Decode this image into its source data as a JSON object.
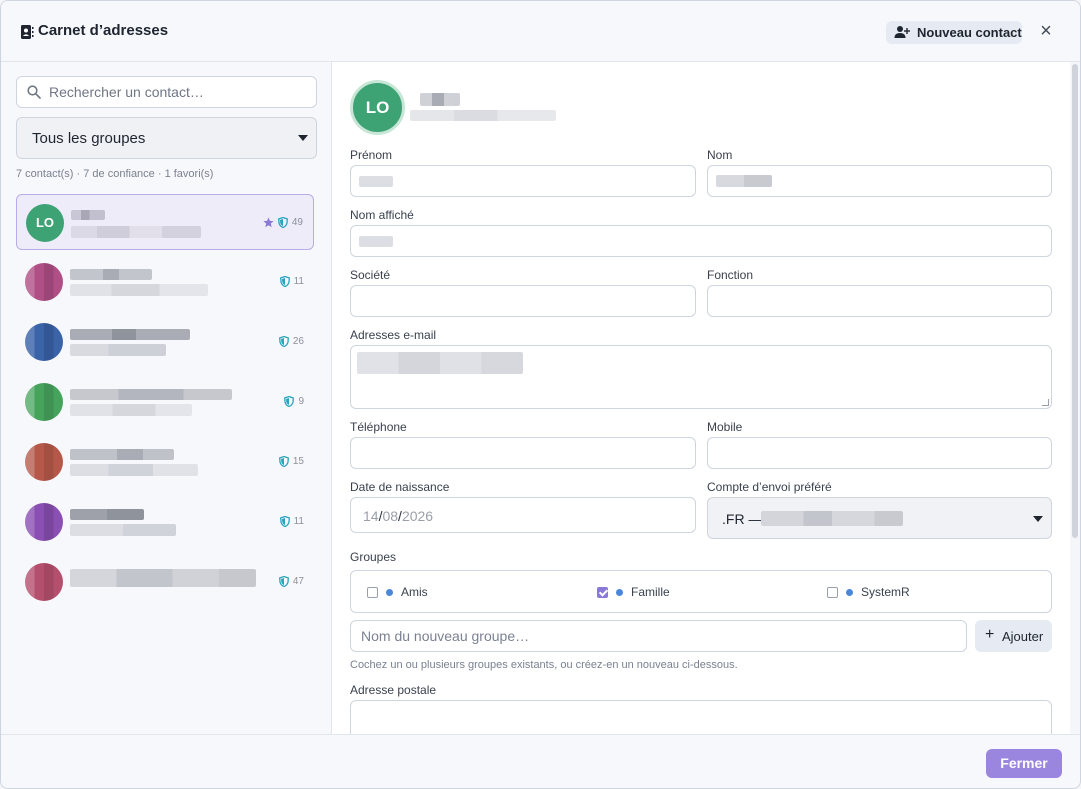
{
  "header": {
    "title": "Carnet d’adresses",
    "new_contact_label": "Nouveau contact",
    "close_symbol": "×",
    "icons": {
      "title": "address-book-icon",
      "new": "user-plus-icon",
      "close": "close-icon"
    }
  },
  "sidebar": {
    "search_placeholder": "Rechercher un contact…",
    "group_filter": "Tous les groupes",
    "stats": "7 contact(s) · 7 de confiance · 1 favori(s)",
    "contacts": [
      {
        "initials": "LO",
        "count": "49",
        "favorite": true,
        "selected": true
      },
      {
        "initials": "",
        "count": "11",
        "favorite": false,
        "selected": false,
        "color": "#b04f86"
      },
      {
        "initials": "",
        "count": "26",
        "favorite": false,
        "selected": false,
        "color": "#3a63a8"
      },
      {
        "initials": "",
        "count": "9",
        "favorite": false,
        "selected": false,
        "color": "#46a35c"
      },
      {
        "initials": "",
        "count": "15",
        "favorite": false,
        "selected": false,
        "color": "#b5584a"
      },
      {
        "initials": "",
        "count": "11",
        "favorite": false,
        "selected": false,
        "color": "#8a4fb3"
      },
      {
        "initials": "",
        "count": "47",
        "favorite": false,
        "selected": false,
        "color": "#b54f6e"
      }
    ]
  },
  "form": {
    "avatar_initials": "LO",
    "labels": {
      "first_name": "Prénom",
      "last_name": "Nom",
      "display_name": "Nom affiché",
      "company": "Société",
      "job": "Fonction",
      "emails": "Adresses e-mail",
      "phone": "Téléphone",
      "mobile": "Mobile",
      "birthdate": "Date de naissance",
      "send_account": "Compte d’envoi préféré",
      "groups": "Groupes",
      "address": "Adresse postale"
    },
    "birthdate": {
      "day": "14",
      "month": "08",
      "year": "2026",
      "sep": "/"
    },
    "send_account_value": ".FR —",
    "groups": [
      {
        "name": "Amis",
        "checked": false,
        "color": "#4a86d9"
      },
      {
        "name": "Famille",
        "checked": true,
        "color": "#4a86d9"
      },
      {
        "name": "SystemR",
        "checked": false,
        "color": "#4a86d9"
      }
    ],
    "new_group_placeholder": "Nom du nouveau groupe…",
    "add_label": "Ajouter",
    "add_symbol": "+",
    "groups_hint": "Cochez un ou plusieurs groupes existants, ou créez-en un nouveau ci-dessous."
  },
  "footer": {
    "close_label": "Fermer"
  },
  "colors": {
    "accent": "#9a86de",
    "avatar_green": "#3da274",
    "trusted": "#2aa3c0"
  }
}
